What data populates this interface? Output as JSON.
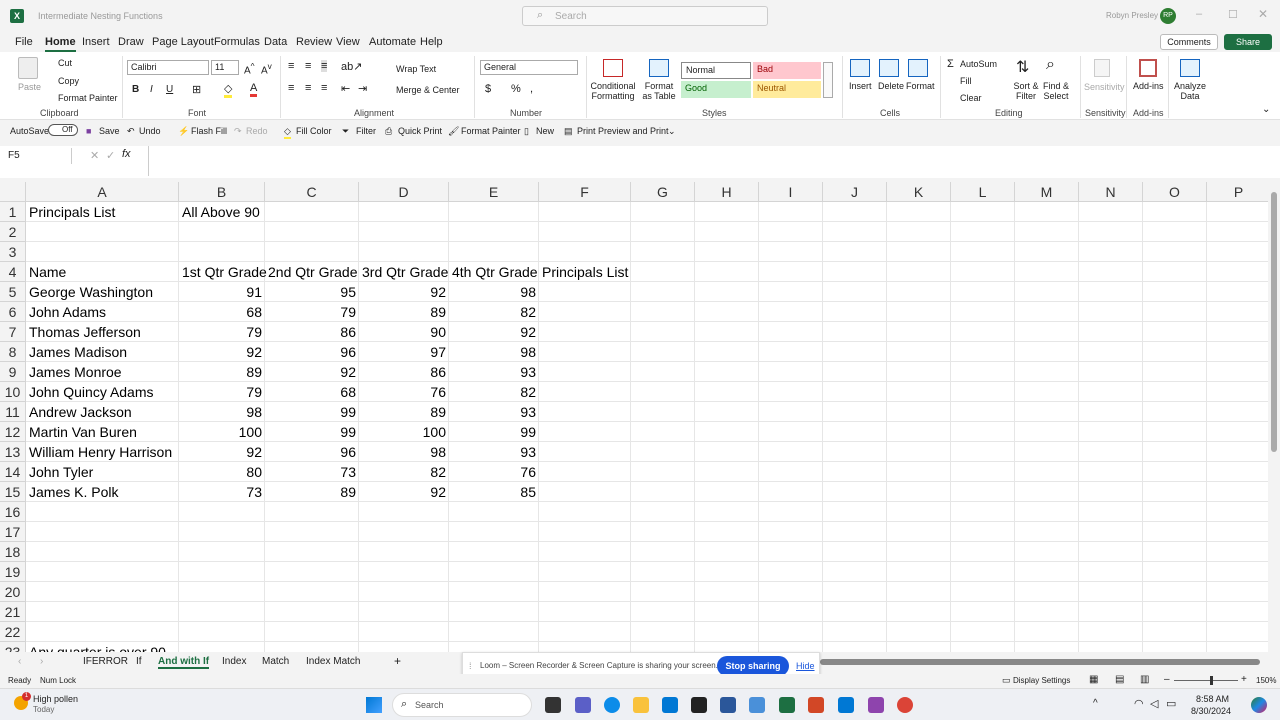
{
  "window": {
    "title": "Intermediate Nesting Functions",
    "search_placeholder": "Search",
    "user_name": "Robyn Presley",
    "user_initials": "RP"
  },
  "menu": {
    "items": [
      "File",
      "Home",
      "Insert",
      "Draw",
      "Page Layout",
      "Formulas",
      "Data",
      "Review",
      "View",
      "Automate",
      "Help"
    ],
    "active": "Home",
    "comments": "Comments",
    "share": "Share"
  },
  "ribbon": {
    "clipboard": {
      "paste": "Paste",
      "cut": "Cut",
      "copy": "Copy",
      "format_painter": "Format Painter",
      "label": "Clipboard"
    },
    "font": {
      "name": "Calibri",
      "size": "11",
      "label": "Font"
    },
    "alignment": {
      "wrap_text": "Wrap Text",
      "merge_center": "Merge & Center",
      "label": "Alignment"
    },
    "number": {
      "format": "General",
      "label": "Number"
    },
    "styles": {
      "conditional": "Conditional Formatting",
      "format_table": "Format as Table",
      "normal": "Normal",
      "bad": "Bad",
      "good": "Good",
      "neutral": "Neutral",
      "label": "Styles"
    },
    "cells": {
      "insert": "Insert",
      "delete": "Delete",
      "format": "Format",
      "label": "Cells"
    },
    "editing": {
      "autosum": "AutoSum",
      "fill": "Fill",
      "clear": "Clear",
      "sort_filter": "Sort & Filter",
      "find_select": "Find & Select",
      "label": "Editing"
    },
    "sensitivity": {
      "button": "Sensitivity",
      "label": "Sensitivity"
    },
    "addins": {
      "button": "Add-ins",
      "label": "Add-ins"
    },
    "analyze": {
      "button": "Analyze Data"
    }
  },
  "qat": {
    "autosave": "AutoSave",
    "autosave_state": "Off",
    "save": "Save",
    "undo": "Undo",
    "flash_fill": "Flash Fill",
    "redo": "Redo",
    "fill_color": "Fill Color",
    "filter": "Filter",
    "quick_print": "Quick Print",
    "format_painter": "Format Painter",
    "new": "New",
    "print_preview": "Print Preview and Print"
  },
  "formula_bar": {
    "name_box": "F5",
    "formula": ""
  },
  "sheet": {
    "columns": [
      "A",
      "B",
      "C",
      "D",
      "E",
      "F",
      "G",
      "H",
      "I",
      "J",
      "K",
      "L",
      "M",
      "N",
      "O",
      "P"
    ],
    "row_numbers": [
      "1",
      "2",
      "3",
      "4",
      "5",
      "6",
      "7",
      "8",
      "9",
      "10",
      "11",
      "12",
      "13",
      "14",
      "15",
      "16",
      "17",
      "18",
      "19",
      "20",
      "21",
      "22",
      "23"
    ],
    "a1": "Principals List",
    "b1": "All Above 90",
    "headers": [
      "Name",
      "1st Qtr Grade",
      "2nd Qtr Grade",
      "3rd Qtr Grade",
      "4th Qtr Grade",
      "Principals List"
    ],
    "rows": [
      {
        "name": "George Washington",
        "q1": "91",
        "q2": "95",
        "q3": "92",
        "q4": "98"
      },
      {
        "name": "John Adams",
        "q1": "68",
        "q2": "79",
        "q3": "89",
        "q4": "82"
      },
      {
        "name": "Thomas Jefferson",
        "q1": "79",
        "q2": "86",
        "q3": "90",
        "q4": "92"
      },
      {
        "name": "James Madison",
        "q1": "92",
        "q2": "96",
        "q3": "97",
        "q4": "98"
      },
      {
        "name": "James Monroe",
        "q1": "89",
        "q2": "92",
        "q3": "86",
        "q4": "93"
      },
      {
        "name": "John Quincy Adams",
        "q1": "79",
        "q2": "68",
        "q3": "76",
        "q4": "82"
      },
      {
        "name": "Andrew Jackson",
        "q1": "98",
        "q2": "99",
        "q3": "89",
        "q4": "93"
      },
      {
        "name": "Martin Van Buren",
        "q1": "100",
        "q2": "99",
        "q3": "100",
        "q4": "99"
      },
      {
        "name": "William Henry Harrison",
        "q1": "92",
        "q2": "96",
        "q3": "98",
        "q4": "93"
      },
      {
        "name": "John Tyler",
        "q1": "80",
        "q2": "73",
        "q3": "82",
        "q4": "76"
      },
      {
        "name": "James K. Polk",
        "q1": "73",
        "q2": "89",
        "q3": "92",
        "q4": "85"
      }
    ],
    "a23": "Any quarter is over 90"
  },
  "tabs": {
    "items": [
      "IFERROR",
      "If",
      "And with If",
      "Index",
      "Match",
      "Index Match"
    ],
    "active": "And with If"
  },
  "loom": {
    "message": "Loom – Screen Recorder & Screen Capture is sharing your screen.",
    "stop": "Stop sharing",
    "hide": "Hide"
  },
  "status": {
    "ready": "Ready",
    "num_lock": "Num Lock",
    "display_settings": "Display Settings",
    "zoom": "150%"
  },
  "taskbar": {
    "weather": "High pollen",
    "weather_sub": "Today",
    "search": "Search",
    "time": "8:58 AM",
    "date": "8/30/2024",
    "notif": "1"
  }
}
